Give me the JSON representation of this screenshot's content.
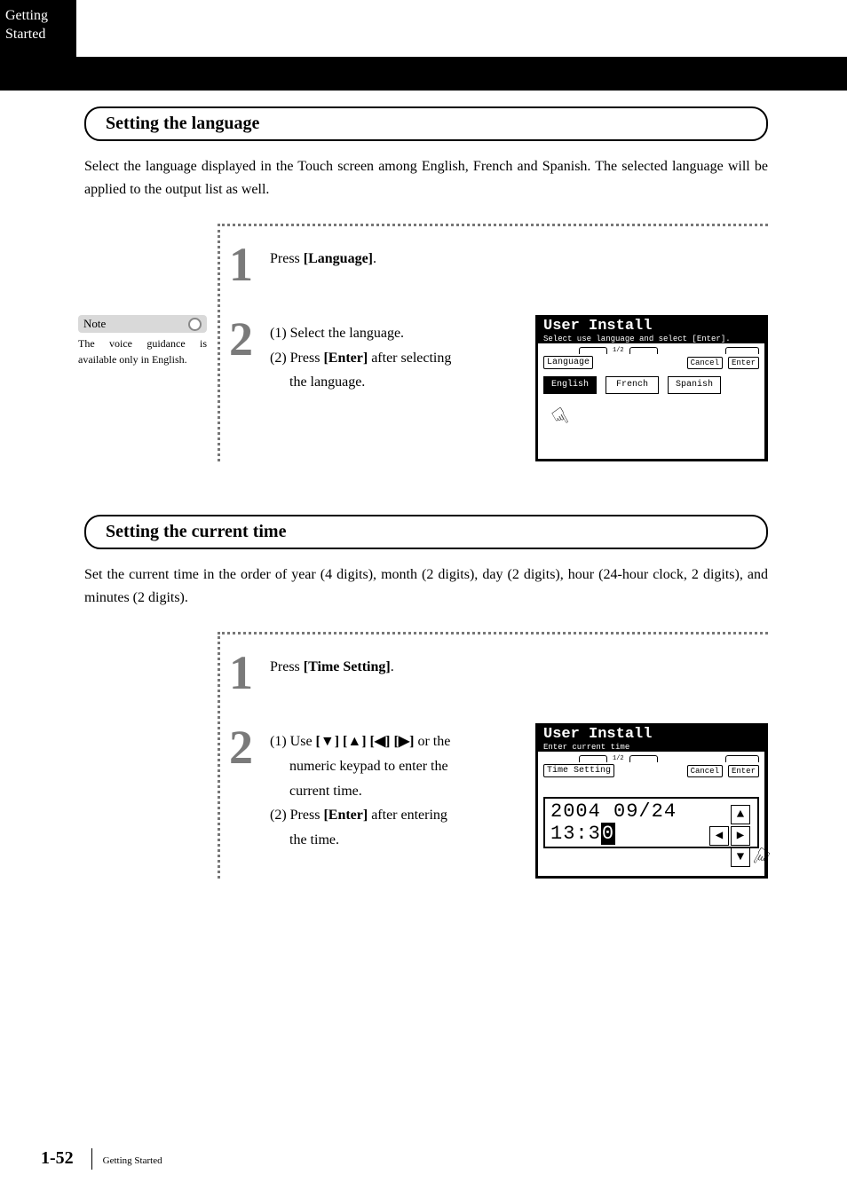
{
  "sideTab": {
    "line1": "Getting",
    "line2": "Started"
  },
  "section1": {
    "header": "Setting the language",
    "desc": "Select the language displayed in the Touch screen among English, French and Spanish. The selected language will be applied to the output list as well.",
    "step1": {
      "pre": "Press ",
      "bold": "[Language]",
      "post": "."
    },
    "step2": {
      "l1": "(1) Select the language.",
      "l2a": "(2) Press ",
      "l2b": "[Enter]",
      "l2c": " after selecting",
      "l3": "the language."
    },
    "note": {
      "label": "Note",
      "body": "The voice guidance is available only in English."
    },
    "screen": {
      "title": "User Install",
      "sub": "Select use language and select [Enter].",
      "fieldLabel": "Language",
      "cancel": "Cancel",
      "enter": "Enter",
      "english": "English",
      "french": "French",
      "spanish": "Spanish"
    }
  },
  "section2": {
    "header": "Setting the current time",
    "desc": "Set the current time in the order of year (4 digits), month (2 digits), day (2 digits), hour (24-hour clock, 2 digits), and minutes (2 digits).",
    "step1": {
      "pre": "Press ",
      "bold": "[Time Setting]",
      "post": "."
    },
    "step2": {
      "l1a": "(1) Use  ",
      "l1b": "[▼] [▲] [◀] [▶]",
      "l1c": " or the",
      "l2": "numeric keypad to enter the",
      "l3": "current time.",
      "l4a": "(2) Press ",
      "l4b": "[Enter]",
      "l4c": " after entering",
      "l5": "the time."
    },
    "screen": {
      "title": "User Install",
      "sub": "Enter current time",
      "fieldLabel": "Time Setting",
      "cancel": "Cancel",
      "enter": "Enter",
      "time_pre": "2004 09/24 13:3",
      "time_cursor": "0",
      "up": "▲",
      "down": "▼",
      "left": "◀",
      "right": "▶"
    }
  },
  "footer": {
    "page": "1-52",
    "label": "Getting Started"
  },
  "glyphs": {
    "hand": "☟"
  }
}
